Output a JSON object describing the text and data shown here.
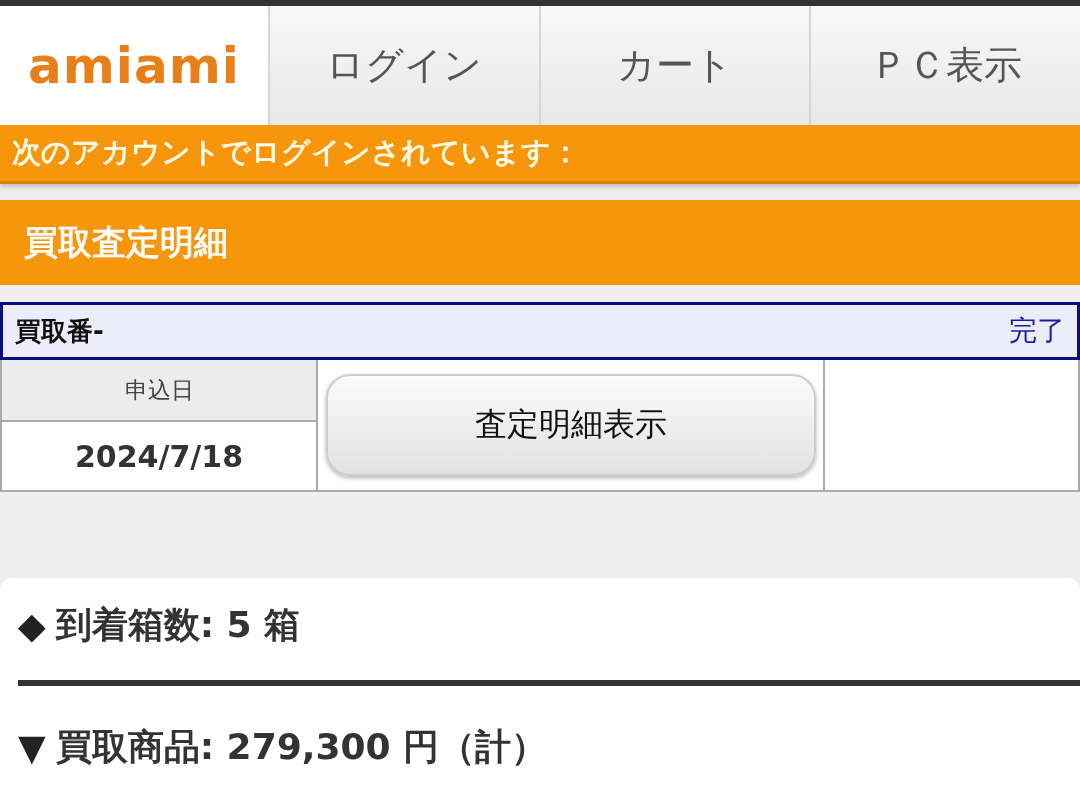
{
  "header": {
    "logo": "amiami",
    "nav": [
      {
        "label": "ログイン"
      },
      {
        "label": "カート"
      },
      {
        "label": "ＰＣ表示"
      }
    ]
  },
  "login_notice": "次のアカウントでログインされています：",
  "page_title": "買取査定明細",
  "purchase": {
    "number_label": "買取番-",
    "status": "完了",
    "date_label": "申込日",
    "date": "2024/7/18",
    "detail_button": "査定明細表示"
  },
  "summary": [
    {
      "marker": "◆",
      "text": "到着箱数: 5 箱"
    },
    {
      "marker": "▼",
      "text": "買取商品: 279,300 円（計）"
    }
  ]
}
